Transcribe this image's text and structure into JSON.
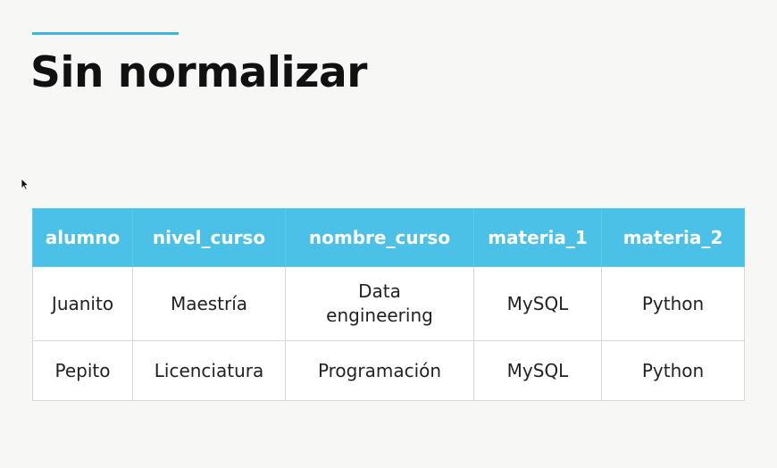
{
  "slide": {
    "title": "Sin normalizar",
    "accent_color": "#3fb6e2"
  },
  "table": {
    "header_color": "#4cc1e8",
    "columns": [
      "alumno",
      "nivel_curso",
      "nombre_curso",
      "materia_1",
      "materia_2"
    ],
    "rows": [
      [
        "Juanito",
        "Maestría",
        "Data engineering",
        "MySQL",
        "Python"
      ],
      [
        "Pepito",
        "Licenciatura",
        "Programación",
        "MySQL",
        "Python"
      ]
    ]
  },
  "cursor": {
    "icon": "mouse-pointer-icon"
  }
}
